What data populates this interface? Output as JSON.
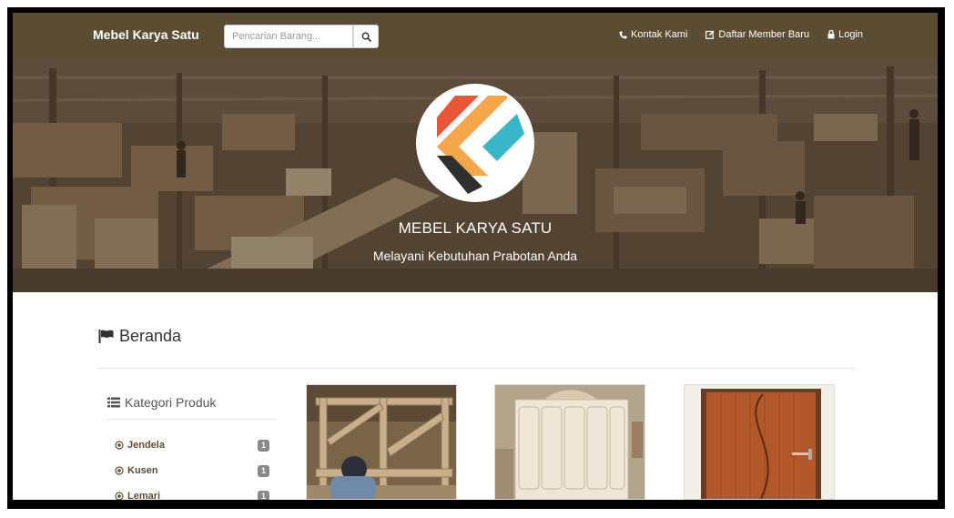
{
  "navbar": {
    "brand": "Mebel Karya Satu",
    "search_placeholder": "Pencarian Barang...",
    "links": [
      {
        "label": "Kontak Kami",
        "icon": "phone-icon"
      },
      {
        "label": "Daftar Member Baru",
        "icon": "edit-icon"
      },
      {
        "label": "Login",
        "icon": "lock-icon"
      }
    ]
  },
  "hero": {
    "title": "MEBEL KARYA SATU",
    "subtitle": "Melayani Kebutuhan Prabotan Anda"
  },
  "page": {
    "heading": "Beranda",
    "heading_icon": "flag-icon"
  },
  "sidebar": {
    "title": "Kategori Produk",
    "title_icon": "list-icon",
    "categories": [
      {
        "label": "Jendela",
        "count": "1"
      },
      {
        "label": "Kusen",
        "count": "1"
      },
      {
        "label": "Lemari",
        "count": "1"
      }
    ]
  },
  "products": [
    {
      "image": "window-frame-workshop"
    },
    {
      "image": "white-wardrobe"
    },
    {
      "image": "wooden-door"
    }
  ],
  "colors": {
    "navbar": "#5b4d33",
    "accent": "#5b4d33",
    "badge": "#888888"
  }
}
